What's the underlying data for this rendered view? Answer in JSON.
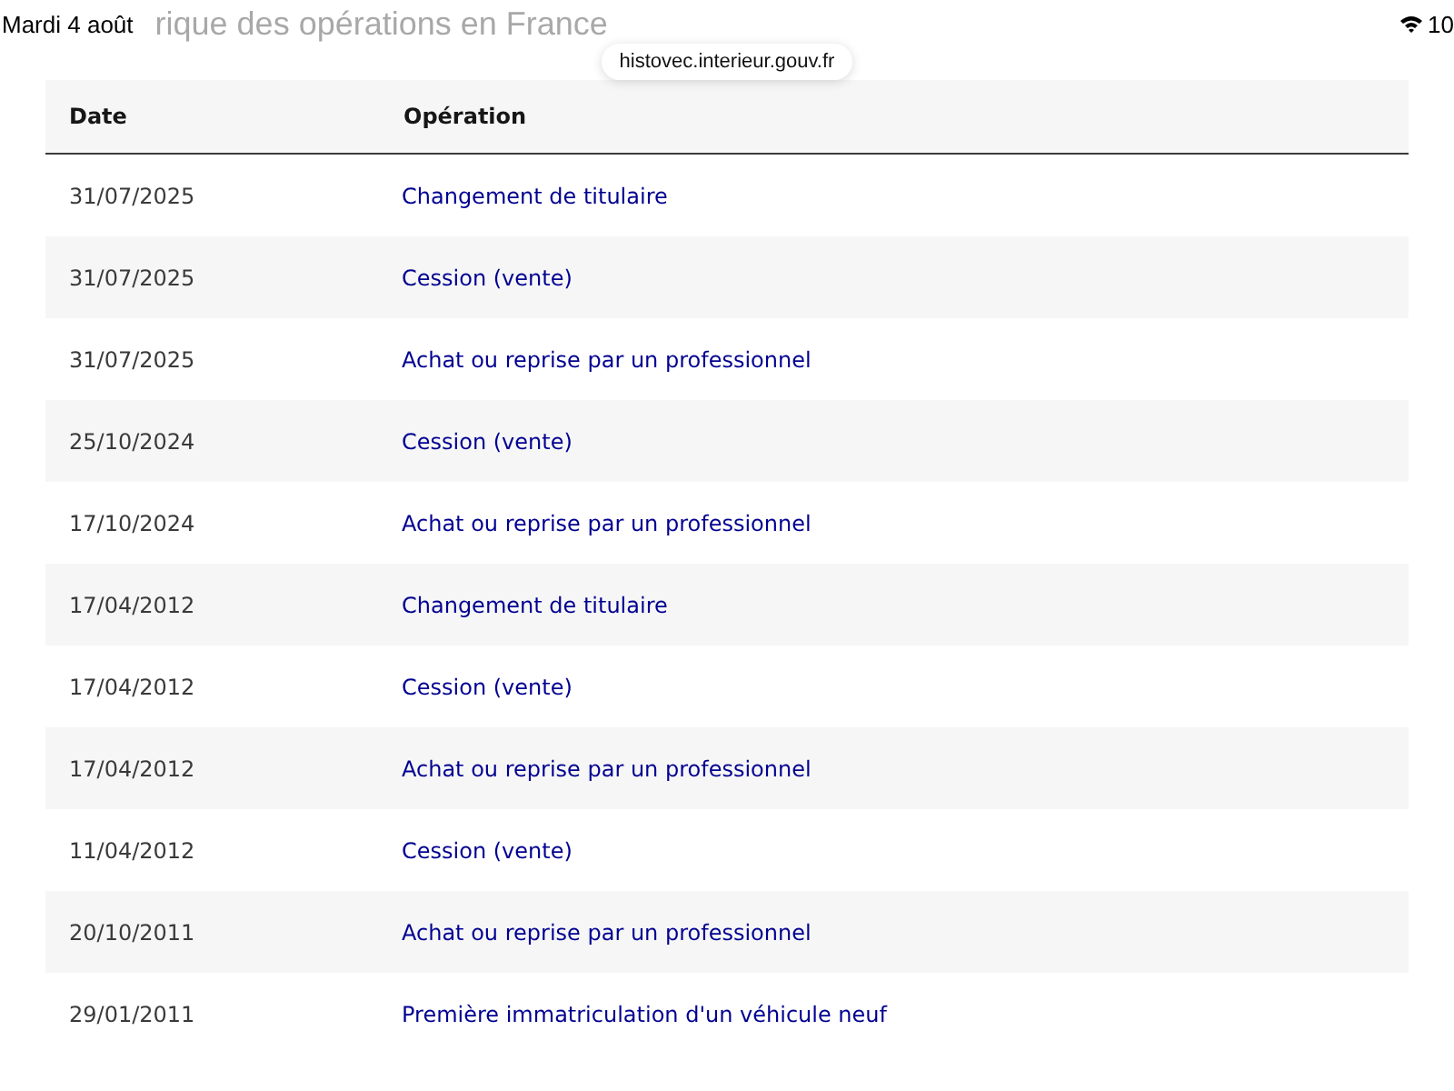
{
  "status_bar": {
    "date": "Mardi 4 août",
    "heading_behind": "rique des opérations en France",
    "battery": "10"
  },
  "address_bar": {
    "url": "histovec.interieur.gouv.fr"
  },
  "table": {
    "columns": [
      "Date",
      "Opération"
    ],
    "rows": [
      {
        "date": "31/07/2025",
        "operation": "Changement de titulaire"
      },
      {
        "date": "31/07/2025",
        "operation": "Cession (vente)"
      },
      {
        "date": "31/07/2025",
        "operation": "Achat ou reprise par un professionnel"
      },
      {
        "date": "25/10/2024",
        "operation": "Cession (vente)"
      },
      {
        "date": "17/10/2024",
        "operation": "Achat ou reprise par un professionnel"
      },
      {
        "date": "17/04/2012",
        "operation": "Changement de titulaire"
      },
      {
        "date": "17/04/2012",
        "operation": "Cession (vente)"
      },
      {
        "date": "17/04/2012",
        "operation": "Achat ou reprise par un professionnel"
      },
      {
        "date": "11/04/2012",
        "operation": "Cession (vente)"
      },
      {
        "date": "20/10/2011",
        "operation": "Achat ou reprise par un professionnel"
      },
      {
        "date": "29/01/2011",
        "operation": "Première immatriculation d'un véhicule neuf"
      }
    ]
  }
}
